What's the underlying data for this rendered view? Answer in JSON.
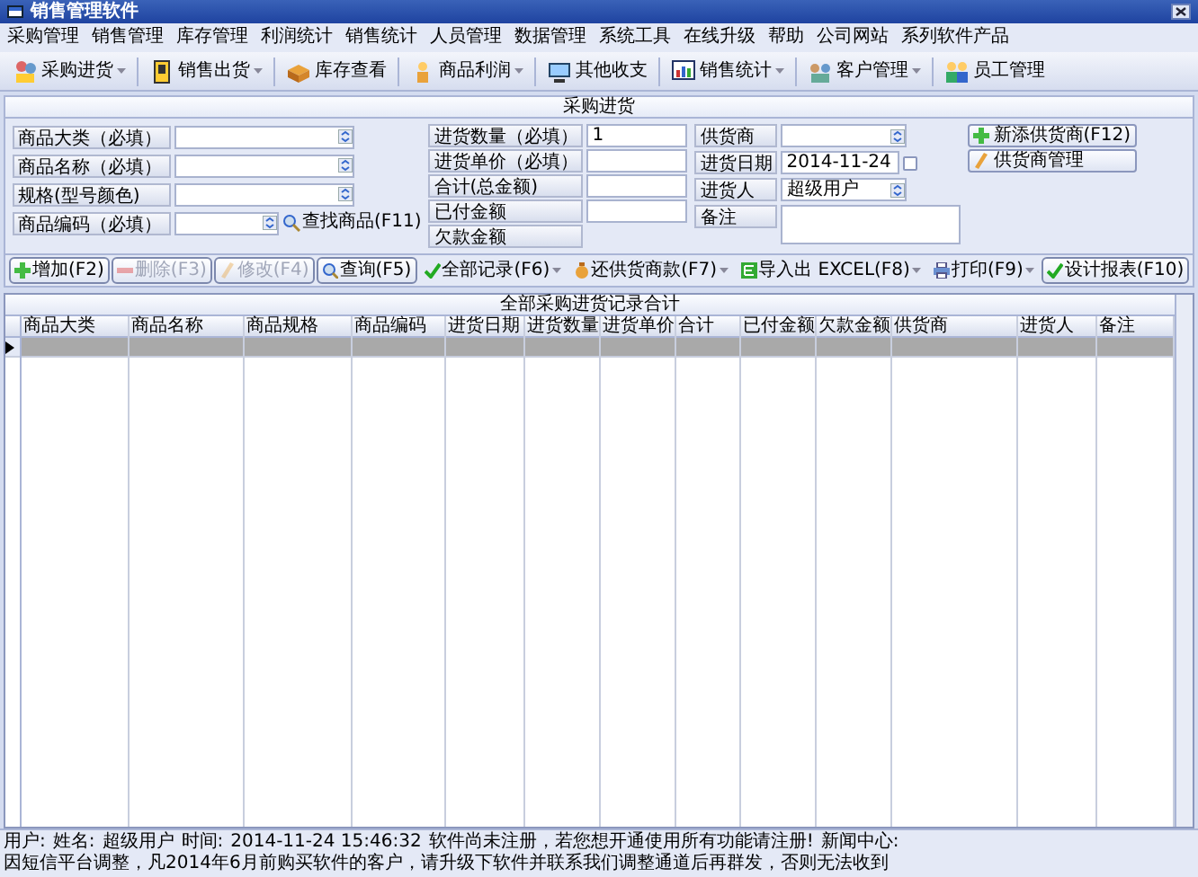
{
  "window": {
    "title": "销售管理软件"
  },
  "menu": [
    "采购管理",
    "销售管理",
    "库存管理",
    "利润统计",
    "销售统计",
    "人员管理",
    "数据管理",
    "系统工具",
    "在线升级",
    "帮助",
    "公司网站",
    "系列软件产品"
  ],
  "toolbar": [
    {
      "label": "采购进货",
      "dropdown": true
    },
    {
      "label": "销售出货",
      "dropdown": true
    },
    {
      "label": "库存查看",
      "dropdown": false
    },
    {
      "label": "商品利润",
      "dropdown": true
    },
    {
      "label": "其他收支",
      "dropdown": false
    },
    {
      "label": "销售统计",
      "dropdown": true
    },
    {
      "label": "客户管理",
      "dropdown": true
    },
    {
      "label": "员工管理",
      "dropdown": false
    }
  ],
  "section_title": "采购进货",
  "form": {
    "left": [
      {
        "label": "商品大类（必填）",
        "kind": "combo"
      },
      {
        "label": "商品名称（必填）",
        "kind": "combo"
      },
      {
        "label": "规格(型号颜色)",
        "kind": "combo"
      },
      {
        "label": "商品编码（必填）",
        "kind": "search",
        "button": "查找商品(F11)"
      }
    ],
    "middle": [
      {
        "label": "进货数量（必填）",
        "kind": "text",
        "value": "1"
      },
      {
        "label": "进货单价（必填）",
        "kind": "text"
      },
      {
        "label": "合计(总金额)",
        "kind": "text"
      },
      {
        "label": "已付金额",
        "kind": "text"
      },
      {
        "label": "欠款金额",
        "kind": "none"
      }
    ],
    "right": [
      {
        "label": "供货商",
        "kind": "combo"
      },
      {
        "label": "进货日期",
        "kind": "date",
        "value": "2014-11-24"
      },
      {
        "label": "进货人",
        "kind": "combo",
        "value": "超级用户"
      },
      {
        "label": "备注",
        "kind": "memo"
      }
    ],
    "supplier_buttons": [
      "新添供货商(F12)",
      "供货商管理"
    ]
  },
  "actions": [
    {
      "label": "增加(F2)",
      "disabled": false,
      "bordered": true,
      "dropdown": false
    },
    {
      "label": "删除(F3)",
      "disabled": true,
      "bordered": true,
      "dropdown": false
    },
    {
      "label": "修改(F4)",
      "disabled": true,
      "bordered": true,
      "dropdown": false
    },
    {
      "label": "查询(F5)",
      "disabled": false,
      "bordered": true,
      "dropdown": false
    },
    {
      "label": "全部记录(F6)",
      "disabled": false,
      "bordered": false,
      "dropdown": true
    },
    {
      "label": "还供货商款(F7)",
      "disabled": false,
      "bordered": false,
      "dropdown": true
    },
    {
      "label": "导入出 EXCEL(F8)",
      "disabled": false,
      "bordered": false,
      "dropdown": true
    },
    {
      "label": "打印(F9)",
      "disabled": false,
      "bordered": false,
      "dropdown": true
    },
    {
      "label": "设计报表(F10)",
      "disabled": false,
      "bordered": true,
      "dropdown": false
    }
  ],
  "grid": {
    "title": "全部采购进货记录合计",
    "columns": [
      "商品大类",
      "商品名称",
      "商品规格",
      "商品编码",
      "进货日期",
      "进货数量",
      "进货单价",
      "合计",
      "已付金额",
      "欠款金额",
      "供货商",
      "进货人",
      "备注"
    ],
    "rows": [
      {
        "selected": true
      }
    ]
  },
  "status_bar": [
    "用户:",
    "姓名:",
    "超级用户",
    "时间:",
    "2014-11-24 15:46:32",
    "软件尚未注册，若您想开通使用所有功能请注册!",
    "新闻中心:",
    "因短信平台调整，凡2014年6月前购买软件的客户，请升级下软件并联系我们调整通道后再群发，否则无法收到"
  ]
}
